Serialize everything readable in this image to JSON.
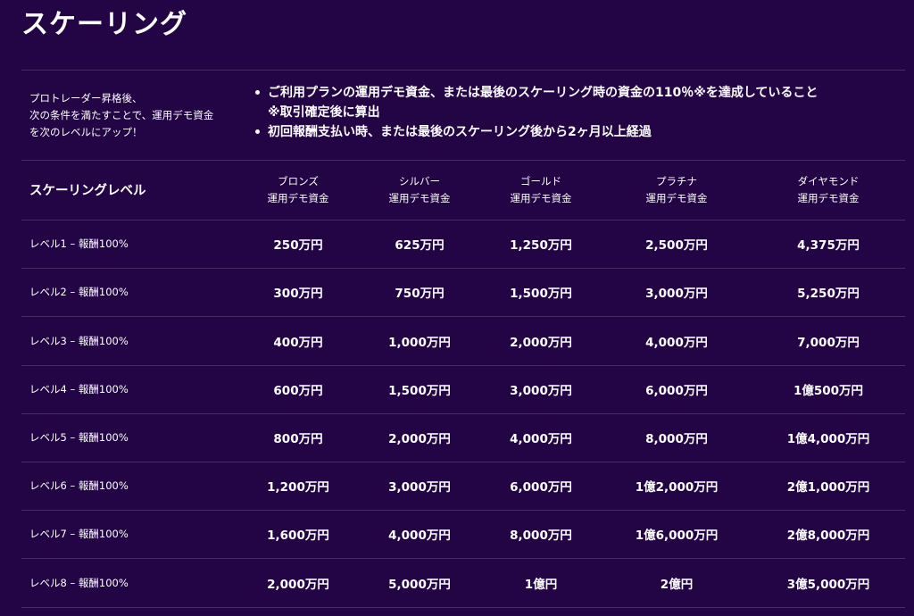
{
  "page": {
    "title": "スケーリング"
  },
  "intro": {
    "text": "プロトレーダー昇格後、\n次の条件を満たすことで、運用デモ資金\nを次のレベルにアップ！"
  },
  "conditions": [
    {
      "text": "ご利用プランの運用デモ資金、または最後のスケーリング時の資金の110％※を達成していること",
      "note": "※取引確定後に算出"
    },
    {
      "text": "初回報酬支払い時、または最後のスケーリング後から2ヶ月以上経過",
      "note": ""
    }
  ],
  "table": {
    "header_title": "スケーリングレベル",
    "columns": [
      {
        "name": "ブロンズ",
        "sub": "運用デモ資金"
      },
      {
        "name": "シルバー",
        "sub": "運用デモ資金"
      },
      {
        "name": "ゴールド",
        "sub": "運用デモ資金"
      },
      {
        "name": "プラチナ",
        "sub": "運用デモ資金"
      },
      {
        "name": "ダイヤモンド",
        "sub": "運用デモ資金"
      }
    ],
    "rows": [
      {
        "label": "レベル1 – 報酬100%",
        "values": [
          "250万円",
          "625万円",
          "1,250万円",
          "2,500万円",
          "4,375万円"
        ]
      },
      {
        "label": "レベル2 – 報酬100%",
        "values": [
          "300万円",
          "750万円",
          "1,500万円",
          "3,000万円",
          "5,250万円"
        ]
      },
      {
        "label": "レベル3 – 報酬100%",
        "values": [
          "400万円",
          "1,000万円",
          "2,000万円",
          "4,000万円",
          "7,000万円"
        ]
      },
      {
        "label": "レベル4 – 報酬100%",
        "values": [
          "600万円",
          "1,500万円",
          "3,000万円",
          "6,000万円",
          "1億500万円"
        ]
      },
      {
        "label": "レベル5 – 報酬100%",
        "values": [
          "800万円",
          "2,000万円",
          "4,000万円",
          "8,000万円",
          "1億4,000万円"
        ]
      },
      {
        "label": "レベル6 – 報酬100%",
        "values": [
          "1,200万円",
          "3,000万円",
          "6,000万円",
          "1億2,000万円",
          "2億1,000万円"
        ]
      },
      {
        "label": "レベル7 – 報酬100%",
        "values": [
          "1,600万円",
          "4,000万円",
          "8,000万円",
          "1億6,000万円",
          "2億8,000万円"
        ]
      },
      {
        "label": "レベル8 – 報酬100%",
        "values": [
          "2,000万円",
          "5,000万円",
          "1億円",
          "2億円",
          "3億5,000万円"
        ]
      }
    ]
  },
  "colors": {
    "background": "#230546",
    "text": "#ffffff",
    "divider": "rgba(255,255,255,0.16)"
  }
}
